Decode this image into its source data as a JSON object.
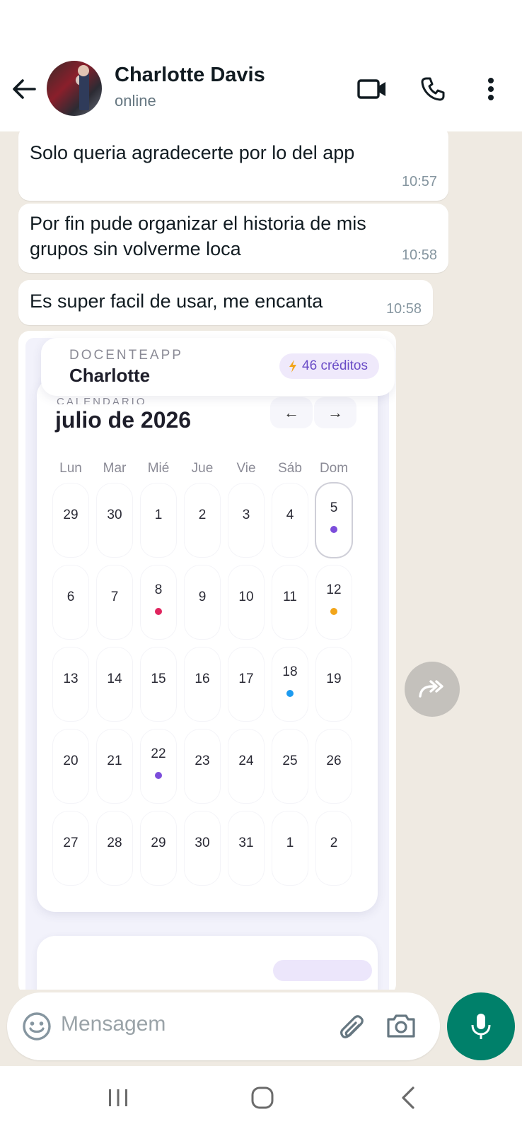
{
  "header": {
    "contact_name": "Charlotte Davis",
    "status": "online"
  },
  "messages": [
    {
      "text": "Solo queria agradecerte por lo del app",
      "time": "10:57"
    },
    {
      "text_line1": "Por fin pude organizar el historia de mis",
      "text_line2": "grupos sin volverme loca",
      "time": "10:58"
    },
    {
      "text": "Es super facil de usar, me encanta",
      "time": "10:58"
    }
  ],
  "image": {
    "brand": "DOCENTEAPP",
    "user": "Charlotte",
    "credits": "46 créditos",
    "calendar": {
      "eyebrow": "CALENDARIO",
      "month": "julio de 2026",
      "prev": "←",
      "next": "→",
      "weekdays": [
        "Lun",
        "Mar",
        "Mié",
        "Jue",
        "Vie",
        "Sáb",
        "Dom"
      ],
      "days": [
        "29",
        "30",
        "1",
        "2",
        "3",
        "4",
        "5",
        "6",
        "7",
        "8",
        "9",
        "10",
        "11",
        "12",
        "13",
        "14",
        "15",
        "16",
        "17",
        "18",
        "19",
        "20",
        "21",
        "22",
        "23",
        "24",
        "25",
        "26",
        "27",
        "28",
        "29",
        "30",
        "31",
        "1",
        "2"
      ],
      "today_index": 6,
      "markers": [
        {
          "index": 6,
          "color": "#7c4ddb"
        },
        {
          "index": 9,
          "color": "#e0245e"
        },
        {
          "index": 13,
          "color": "#f2a51a"
        },
        {
          "index": 19,
          "color": "#1d9bf0"
        },
        {
          "index": 23,
          "color": "#7c4ddb"
        }
      ]
    }
  },
  "input": {
    "placeholder": "Mensagem"
  },
  "icons": {
    "back": "arrow-left-icon",
    "video": "video-call-icon",
    "phone": "phone-icon",
    "menu": "more-vertical-icon",
    "forward": "forward-icon",
    "emoji": "emoji-icon",
    "attach": "paperclip-icon",
    "camera": "camera-icon",
    "mic": "microphone-icon"
  },
  "colors": {
    "accent": "#00806a",
    "credits_text": "#6a4cc7"
  }
}
